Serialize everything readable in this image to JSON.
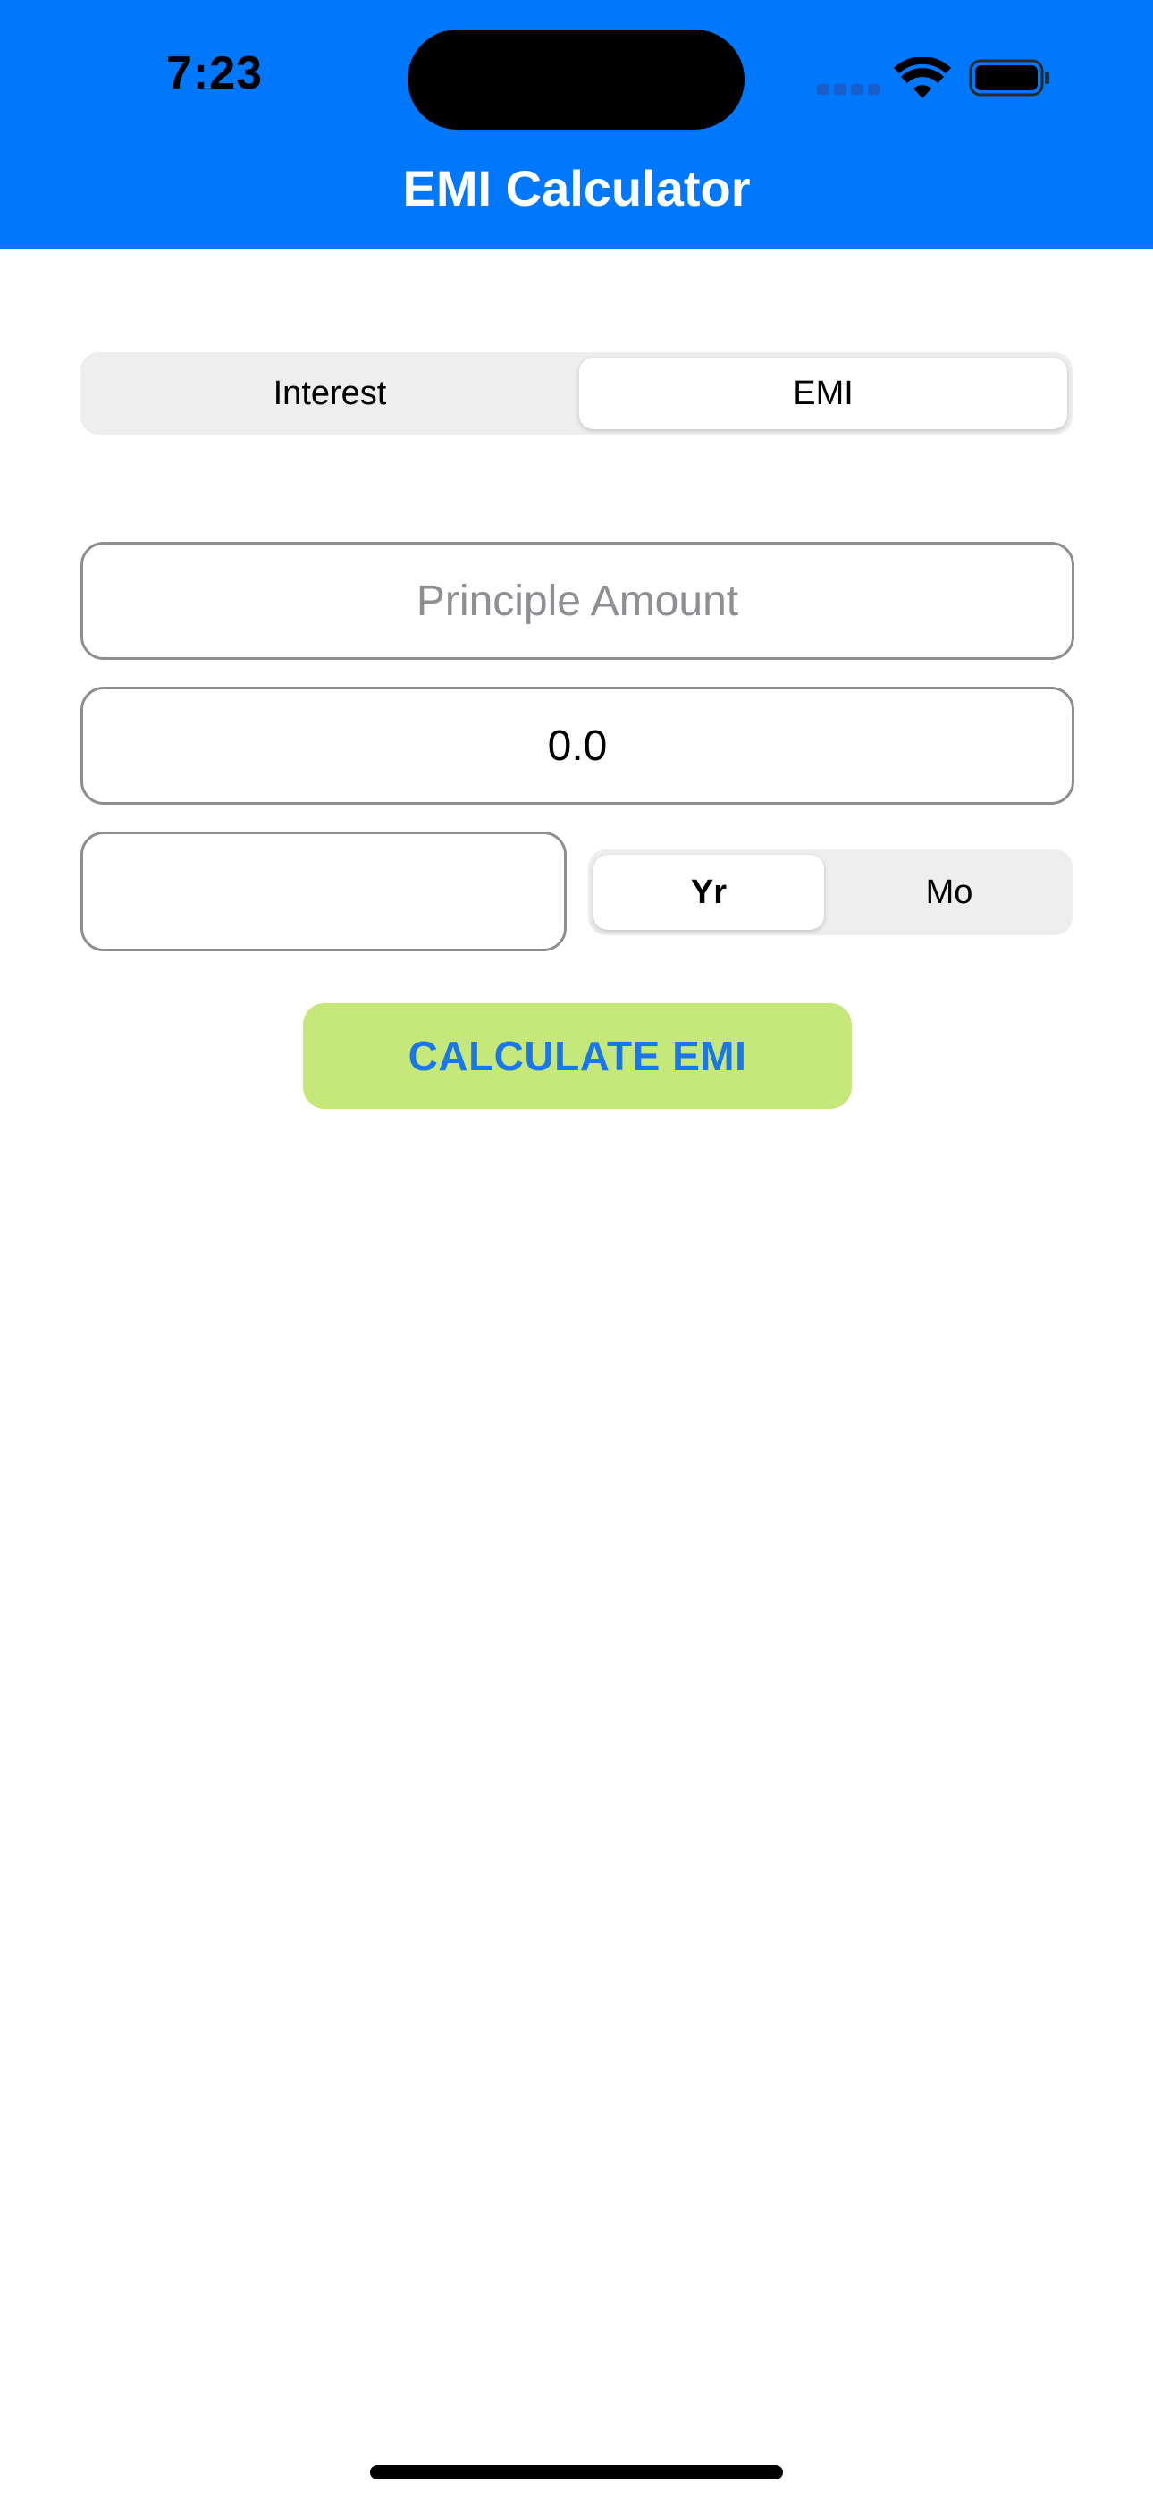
{
  "status_bar": {
    "time": "7:23",
    "icons": [
      "cellular-signal-icon",
      "wifi-icon",
      "battery-icon"
    ]
  },
  "header": {
    "title": "EMI Calculator",
    "background_color": "#0177FB"
  },
  "mode_selector": {
    "options": [
      "Interest",
      "EMI"
    ],
    "selected": "EMI"
  },
  "form": {
    "principle_placeholder": "Principle Amount",
    "principle_value": "",
    "rate_value": "0.0",
    "tenure_value": "",
    "tenure_unit": {
      "options": [
        "Yr",
        "Mo"
      ],
      "selected": "Yr"
    }
  },
  "calculate_button": {
    "label": "CALCULATE EMI",
    "background_color": "#C6E87A",
    "text_color": "#1A77E6"
  }
}
